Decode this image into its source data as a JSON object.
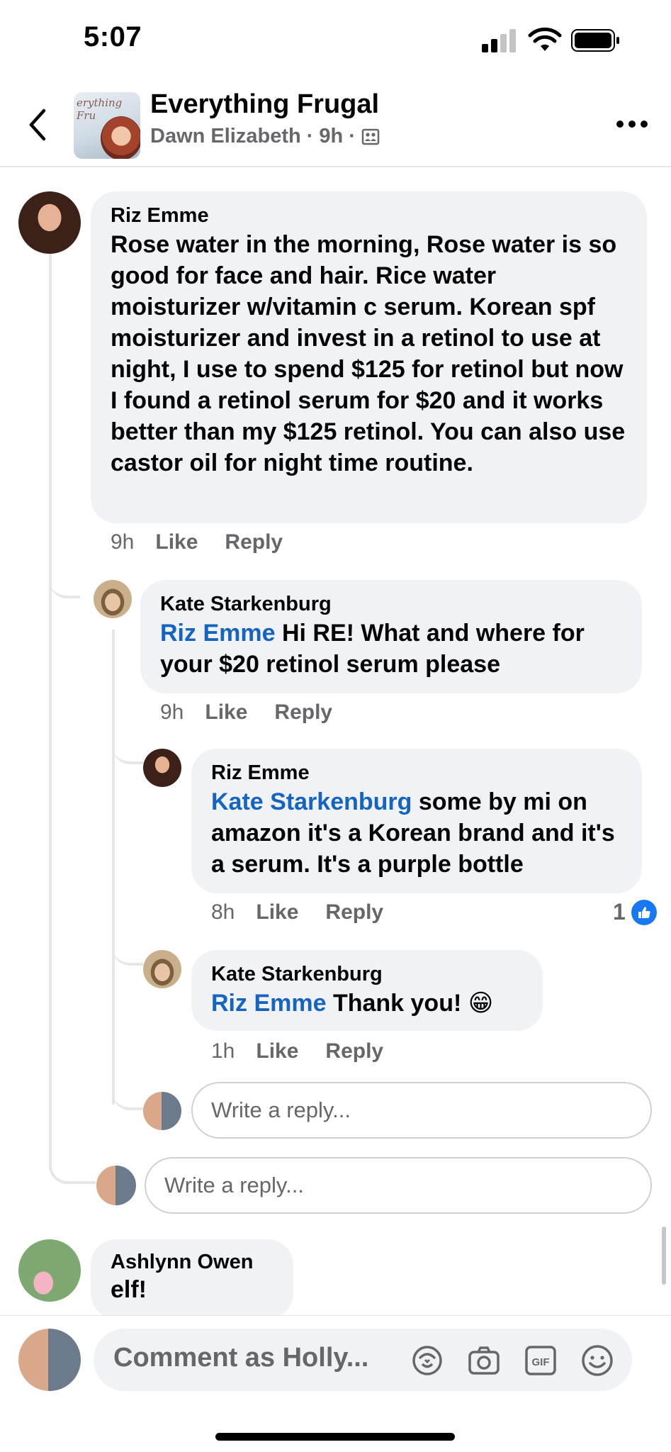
{
  "status": {
    "time": "5:07"
  },
  "header": {
    "avatar_script": "erything Fru",
    "title": "Everything Frugal",
    "author": "Dawn Elizabeth",
    "time": "9h"
  },
  "comments": {
    "c1": {
      "name": "Riz Emme",
      "text": "Rose water in the morning, Rose water is so good for face and hair. Rice water moisturizer w/vitamin c serum. Korean spf moisturizer and invest in a retinol to use at night, I use to spend $125 for retinol but now I found a retinol serum for $20 and it works better than my $125 retinol. You can also use castor oil for night time routine.",
      "time": "9h",
      "like": "Like",
      "reply": "Reply"
    },
    "c2": {
      "name": "Kate Starkenburg",
      "mention": "Riz Emme",
      "text": "Hi RE! What and where for your $20 retinol serum please",
      "time": "9h",
      "like": "Like",
      "reply": "Reply"
    },
    "c3": {
      "name": "Riz Emme",
      "mention": "Kate Starkenburg",
      "text": "some by mi on amazon it's a Korean brand and it's a serum. It's a purple bottle",
      "time": "8h",
      "like": "Like",
      "reply": "Reply",
      "reaction_count": "1"
    },
    "c4": {
      "name": "Kate Starkenburg",
      "mention": "Riz Emme",
      "text": "Thank you! 😁",
      "time": "1h",
      "like": "Like",
      "reply": "Reply"
    },
    "c5": {
      "name": "Ashlynn Owen",
      "text": "elf!"
    }
  },
  "reply_boxes": {
    "inner_placeholder": "Write a reply...",
    "outer_placeholder": "Write a reply..."
  },
  "composer": {
    "placeholder": "Comment as Holly...",
    "icons": [
      "avatar-sticker-icon",
      "camera-icon",
      "gif-icon",
      "emoji-icon"
    ]
  },
  "colors": {
    "mention": "#1565c0",
    "like_blue": "#1877f2",
    "bubble": "#f0f2f5",
    "meta_gray": "#65676b"
  }
}
